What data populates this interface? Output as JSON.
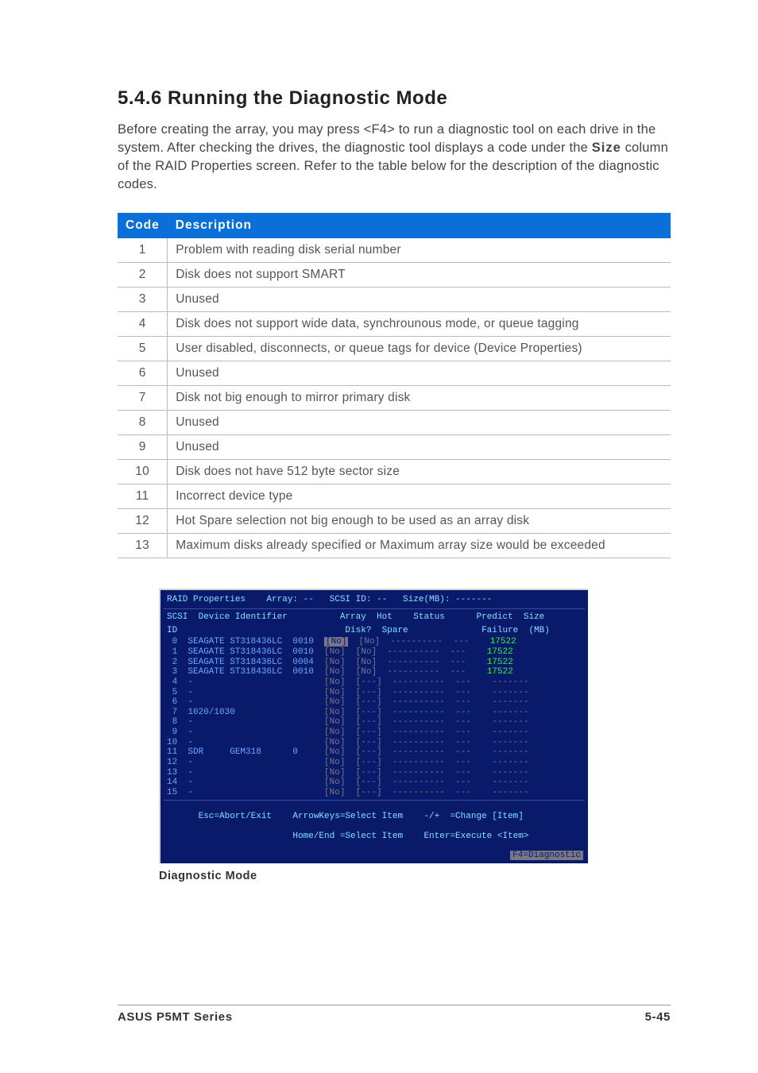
{
  "heading": "5.4.6   Running the Diagnostic Mode",
  "intro_before": "Before creating the array, you may press <F4> to run a diagnostic tool on each drive in the system. After checking the drives, the diagnostic tool displays a code under the ",
  "intro_bold": "Size",
  "intro_after": " column of the RAID Properties screen. Refer to the table below for the  description of the diagnostic codes.",
  "table": {
    "head_code": "Code",
    "head_desc": "Description",
    "rows": [
      {
        "code": "1",
        "desc": "Problem with reading disk serial number"
      },
      {
        "code": "2",
        "desc": "Disk does not support SMART"
      },
      {
        "code": "3",
        "desc": "Unused"
      },
      {
        "code": "4",
        "desc": "Disk does not support wide data, synchrounous mode, or queue tagging"
      },
      {
        "code": "5",
        "desc": "User disabled, disconnects, or queue tags for device (Device Properties)"
      },
      {
        "code": "6",
        "desc": "Unused"
      },
      {
        "code": "7",
        "desc": "Disk not big enough to mirror primary disk"
      },
      {
        "code": "8",
        "desc": "Unused"
      },
      {
        "code": "9",
        "desc": "Unused"
      },
      {
        "code": "10",
        "desc": "Disk does not have 512 byte sector size"
      },
      {
        "code": "11",
        "desc": "Incorrect device type"
      },
      {
        "code": "12",
        "desc": "Hot Spare selection not big enough to be used as an array disk"
      },
      {
        "code": "13",
        "desc": "Maximum disks already specified or Maximum array size would be exceeded"
      }
    ]
  },
  "bios": {
    "title": "RAID Properties    Array: --   SCSI ID: --   Size(MB): -------",
    "col_header1": "SCSI  Device Identifier          Array  Hot    Status      Predict  Size",
    "col_header2": "ID                                Disk?  Spare              Failure  (MB)",
    "rows": [
      {
        "id": " 0",
        "dev": "SEAGATE ST318436LC",
        "rev": "0010",
        "disk": "[No]",
        "diskhi": true,
        "spare": "[No]",
        "status": "----------",
        "predict": "---",
        "size": "17522",
        "szok": true
      },
      {
        "id": " 1",
        "dev": "SEAGATE ST318436LC",
        "rev": "0010",
        "disk": "[No]",
        "diskhi": false,
        "spare": "[No]",
        "status": "----------",
        "predict": "---",
        "size": "17522",
        "szok": true
      },
      {
        "id": " 2",
        "dev": "SEAGATE ST318436LC",
        "rev": "0004",
        "disk": "[No]",
        "diskhi": false,
        "spare": "[No]",
        "status": "----------",
        "predict": "---",
        "size": "17522",
        "szok": true
      },
      {
        "id": " 3",
        "dev": "SEAGATE ST318436LC",
        "rev": "0010",
        "disk": "[No]",
        "diskhi": false,
        "spare": "[No]",
        "status": "----------",
        "predict": "---",
        "size": "17522",
        "szok": true
      },
      {
        "id": " 4",
        "dev": "-",
        "rev": "",
        "disk": "[No]",
        "diskhi": false,
        "spare": "[---]",
        "status": "----------",
        "predict": "---",
        "size": "-------",
        "szok": false
      },
      {
        "id": " 5",
        "dev": "-",
        "rev": "",
        "disk": "[No]",
        "diskhi": false,
        "spare": "[---]",
        "status": "----------",
        "predict": "---",
        "size": "-------",
        "szok": false
      },
      {
        "id": " 6",
        "dev": "-",
        "rev": "",
        "disk": "[No]",
        "diskhi": false,
        "spare": "[---]",
        "status": "----------",
        "predict": "---",
        "size": "-------",
        "szok": false
      },
      {
        "id": " 7",
        "dev": "1020/1030",
        "rev": "",
        "disk": "[No]",
        "diskhi": false,
        "spare": "[---]",
        "status": "----------",
        "predict": "---",
        "size": "-------",
        "szok": false
      },
      {
        "id": " 8",
        "dev": "-",
        "rev": "",
        "disk": "[No]",
        "diskhi": false,
        "spare": "[---]",
        "status": "----------",
        "predict": "---",
        "size": "-------",
        "szok": false
      },
      {
        "id": " 9",
        "dev": "-",
        "rev": "",
        "disk": "[No]",
        "diskhi": false,
        "spare": "[---]",
        "status": "----------",
        "predict": "---",
        "size": "-------",
        "szok": false
      },
      {
        "id": "10",
        "dev": "-",
        "rev": "",
        "disk": "[No]",
        "diskhi": false,
        "spare": "[---]",
        "status": "----------",
        "predict": "---",
        "size": "-------",
        "szok": false
      },
      {
        "id": "11",
        "dev": "SDR     GEM318",
        "rev": "0",
        "disk": "[No]",
        "diskhi": false,
        "spare": "[---]",
        "status": "----------",
        "predict": "---",
        "size": "-------",
        "szok": false
      },
      {
        "id": "12",
        "dev": "-",
        "rev": "",
        "disk": "[No]",
        "diskhi": false,
        "spare": "[---]",
        "status": "----------",
        "predict": "---",
        "size": "-------",
        "szok": false
      },
      {
        "id": "13",
        "dev": "-",
        "rev": "",
        "disk": "[No]",
        "diskhi": false,
        "spare": "[---]",
        "status": "----------",
        "predict": "---",
        "size": "-------",
        "szok": false
      },
      {
        "id": "14",
        "dev": "-",
        "rev": "",
        "disk": "[No]",
        "diskhi": false,
        "spare": "[---]",
        "status": "----------",
        "predict": "---",
        "size": "-------",
        "szok": false
      },
      {
        "id": "15",
        "dev": "-",
        "rev": "",
        "disk": "[No]",
        "diskhi": false,
        "spare": "[---]",
        "status": "----------",
        "predict": "---",
        "size": "-------",
        "szok": false
      }
    ],
    "footer1": "Esc=Abort/Exit    ArrowKeys=Select Item    -/+  =Change [Item]",
    "footer2": "                  Home/End =Select Item    Enter=Execute <Item>",
    "f4": "F4=Diagnostic",
    "caption": "Diagnostic Mode"
  },
  "footer_left": "ASUS P5MT Series",
  "footer_right": "5-45"
}
